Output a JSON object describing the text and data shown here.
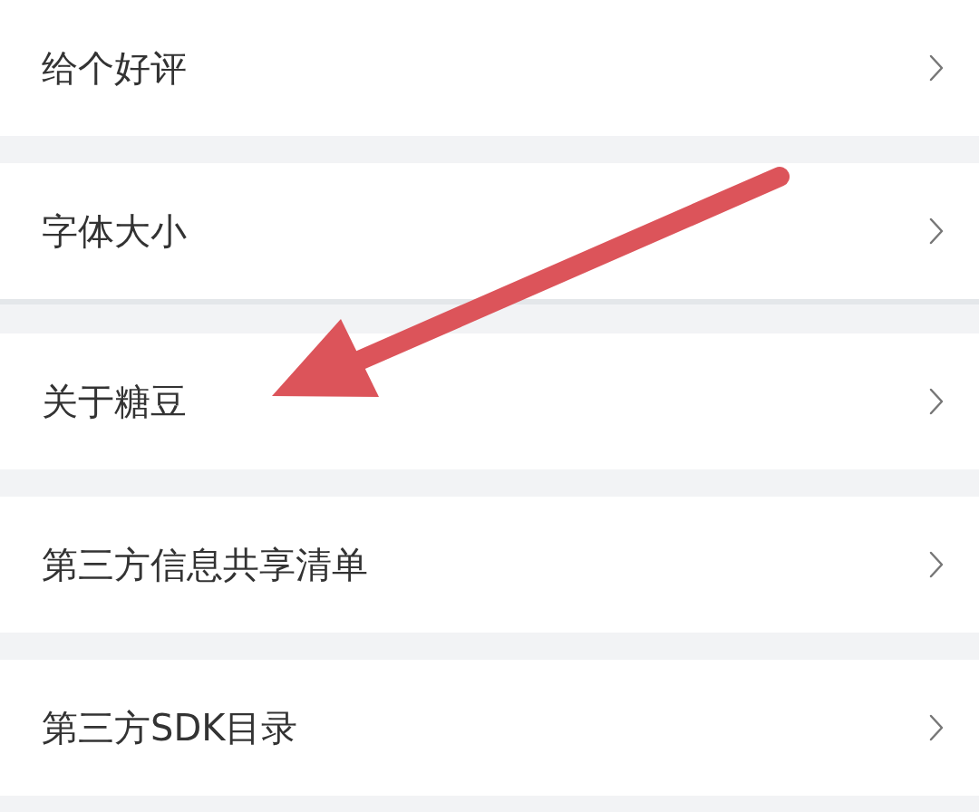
{
  "settings": [
    {
      "label": "给个好评"
    },
    {
      "label": "字体大小"
    },
    {
      "label": "关于糖豆"
    },
    {
      "label": "第三方信息共享清单"
    },
    {
      "label": "第三方SDK目录"
    }
  ]
}
